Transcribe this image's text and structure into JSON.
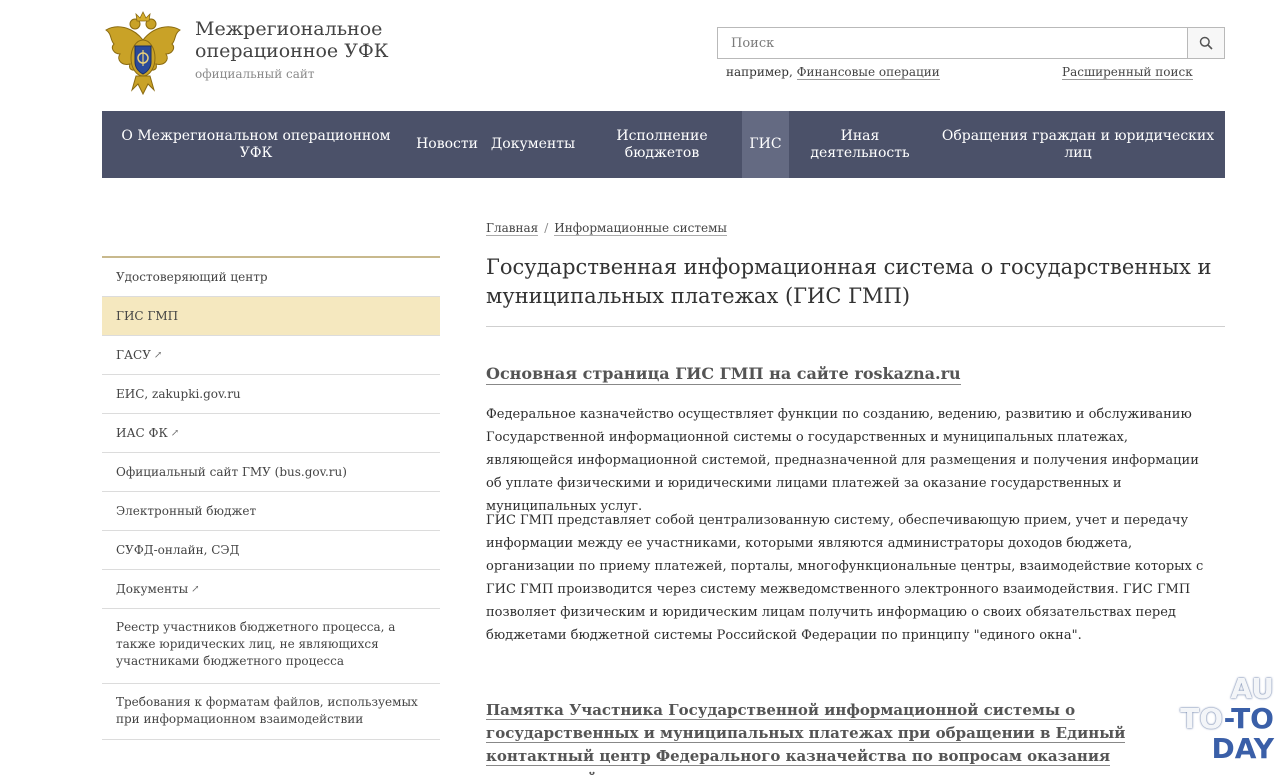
{
  "header": {
    "org_title": "Межрегиональное операционное УФК",
    "org_subtitle": "официальный сайт",
    "search": {
      "placeholder": "Поиск",
      "example_prefix": "например, ",
      "example_link": "Финансовые операции",
      "advanced_label": "Расширенный поиск"
    }
  },
  "nav": {
    "items": [
      {
        "label": "О Межрегиональном операционном УФК"
      },
      {
        "label": "Новости"
      },
      {
        "label": "Документы"
      },
      {
        "label": "Исполнение бюджетов"
      },
      {
        "label": "ГИС"
      },
      {
        "label": "Иная деятельность"
      },
      {
        "label": "Обращения граждан и юридических лиц"
      }
    ],
    "active_index": 4
  },
  "sidebar": {
    "items": [
      {
        "label": "Удостоверяющий центр"
      },
      {
        "label": "ГИС ГМП"
      },
      {
        "label": "ГАСУ"
      },
      {
        "label": "ЕИС, zakupki.gov.ru"
      },
      {
        "label": "ИАС ФК"
      },
      {
        "label": "Официальный сайт ГМУ (bus.gov.ru)"
      },
      {
        "label": "Электронный бюджет"
      },
      {
        "label": "СУФД-онлайн, СЭД"
      },
      {
        "label": "Документы"
      },
      {
        "label": "Реестр участников бюджетного процесса, а также юридических лиц, не являющихся участниками бюджетного процесса"
      },
      {
        "label": "Требования к форматам файлов, используемых при информационном взаимодействии"
      }
    ],
    "active_index": 1,
    "external_icon": "↗"
  },
  "main": {
    "breadcrumb": {
      "home": "Главная",
      "separator": "/",
      "current": "Информационные системы"
    },
    "title": "Государственная информационная система о государственных и муниципальных платежах (ГИС ГМП)",
    "section_link": "Основная страница ГИС ГМП на сайте roskazna.ru",
    "paragraph1": "Федеральное казначейство осуществляет функции по созданию, ведению, развитию и обслуживанию Государственной информационной системы о государственных и муниципальных платежах, являющейся информационной системой, предназначенной для размещения и получения информации об уплате физическими и юридическими лицами платежей за оказание государственных и муниципальных услуг.",
    "paragraph2": "ГИС ГМП представляет собой централизованную систему, обеспечивающую прием, учет и передачу информации между ее участниками, которыми являются администраторы доходов бюджета, организации по приему платежей, порталы, многофункциональные центры, взаимодействие которых с ГИС ГМП производится через систему межведомственного электронного взаимодействия. ГИС ГМП позволяет физическим и юридическим лицам получить информацию о своих обязательствах перед бюджетами бюджетной системы Российской Федерации по принципу \"единого окна\".",
    "memo_link": "Памятка Участника Государственной информационной системы о государственных и муниципальных платежах при обращении в Единый контактный центр Федерального казначейства по вопросам оказания технической поддержки"
  },
  "watermark": {
    "line1": "AU",
    "line2a": "TO",
    "line2b": "-TO",
    "line3": "DAY"
  },
  "colors": {
    "nav_bg": "#4b5169",
    "nav_active": "#646a82",
    "sidebar_active": "#f5e8bf",
    "sidebar_rule": "#c8b98d"
  }
}
